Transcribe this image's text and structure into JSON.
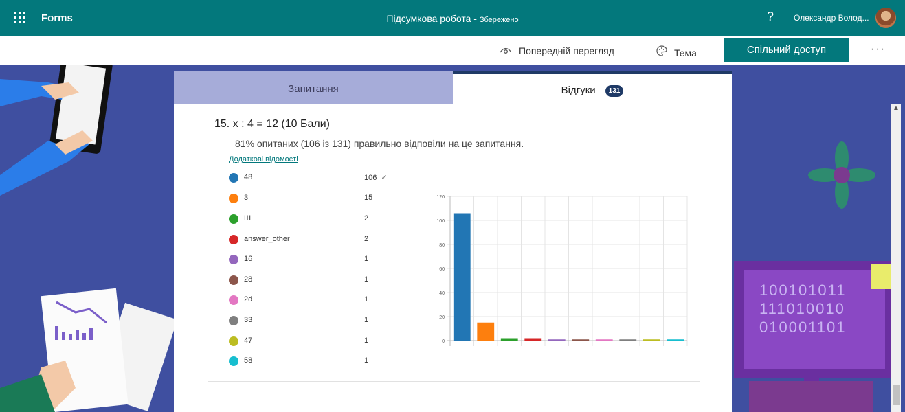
{
  "app": {
    "brand": "Forms",
    "title": "Підсумкова робота",
    "title_sep": " - ",
    "status": "Збережено",
    "help": "?",
    "user": "Олександр Волод..."
  },
  "toolbar": {
    "preview_label": "Попередній перегляд",
    "theme_label": "Тема",
    "share_label": "Спільний доступ",
    "more_label": "···"
  },
  "tabs": {
    "questions": "Запитання",
    "responses": "Відгуки",
    "responses_count": "131"
  },
  "question": {
    "number": "15.",
    "title": "x : 4 = 12 (10 Бали)",
    "summary": "81% опитаних (106 із 131) правильно відповіли на це запитання.",
    "more_details": "Додаткові відомості",
    "correct_mark": "✓",
    "answers": [
      {
        "label": "48",
        "count": "106",
        "color": "#2276b4",
        "correct": true
      },
      {
        "label": "3",
        "count": "15",
        "color": "#fd7f0e"
      },
      {
        "label": "Ш",
        "count": "2",
        "color": "#2ca02c"
      },
      {
        "label": "answer_other",
        "count": "2",
        "color": "#d62728"
      },
      {
        "label": "16",
        "count": "1",
        "color": "#9467bd"
      },
      {
        "label": "28",
        "count": "1",
        "color": "#8c564b"
      },
      {
        "label": "2d",
        "count": "1",
        "color": "#e377c2"
      },
      {
        "label": "33",
        "count": "1",
        "color": "#7f7f7f"
      },
      {
        "label": "47",
        "count": "1",
        "color": "#bcbd22"
      },
      {
        "label": "58",
        "count": "1",
        "color": "#17becf"
      }
    ]
  },
  "chart_data": {
    "type": "bar",
    "categories": [
      "48",
      "3",
      "Ш",
      "answer_other",
      "16",
      "28",
      "2d",
      "33",
      "47",
      "58"
    ],
    "values": [
      106,
      15,
      2,
      2,
      1,
      1,
      1,
      1,
      1,
      1
    ],
    "ylim": [
      0,
      120
    ],
    "yticks": [
      "0",
      "20",
      "40",
      "60",
      "80",
      "100",
      "120"
    ],
    "grid": true,
    "colors": [
      "#2276b4",
      "#fd7f0e",
      "#2ca02c",
      "#d62728",
      "#9467bd",
      "#8c564b",
      "#e377c2",
      "#7f7f7f",
      "#bcbd22",
      "#17becf"
    ]
  },
  "decor": {
    "binary_lines": [
      "100101011",
      "111010010",
      "010001101"
    ]
  }
}
